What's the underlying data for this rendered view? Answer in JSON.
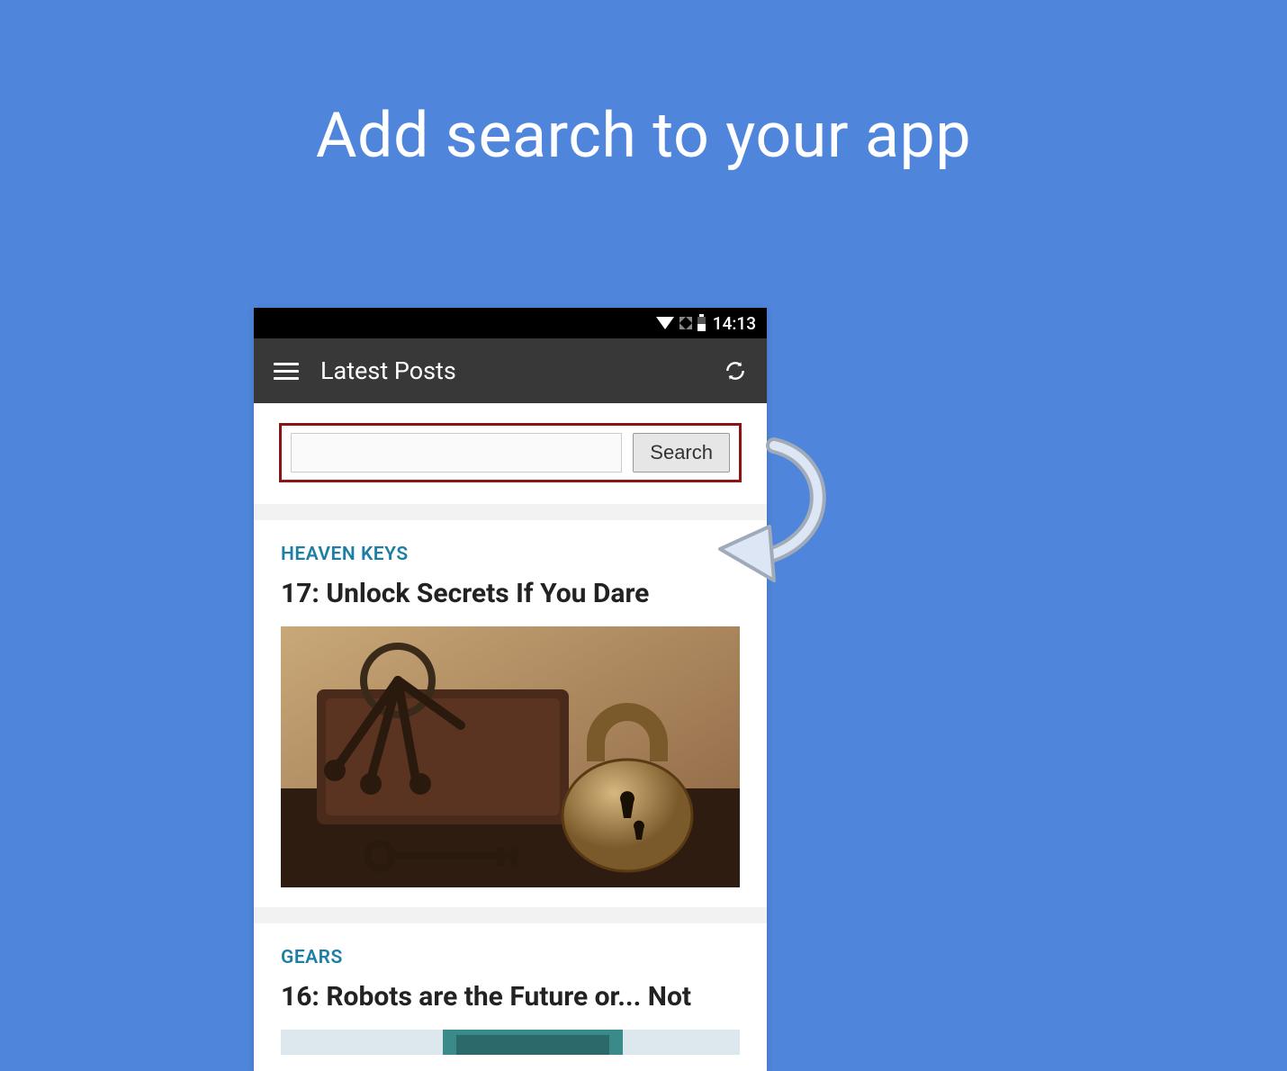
{
  "page_title": "Add search to your app",
  "status_bar": {
    "time": "14:13"
  },
  "app_bar": {
    "title": "Latest Posts"
  },
  "search": {
    "button_label": "Search",
    "input_value": ""
  },
  "posts": [
    {
      "category": "HEAVEN KEYS",
      "title": "17: Unlock Secrets If You Dare"
    },
    {
      "category": "GEARS",
      "title": "16: Robots are the Future or... Not"
    }
  ]
}
